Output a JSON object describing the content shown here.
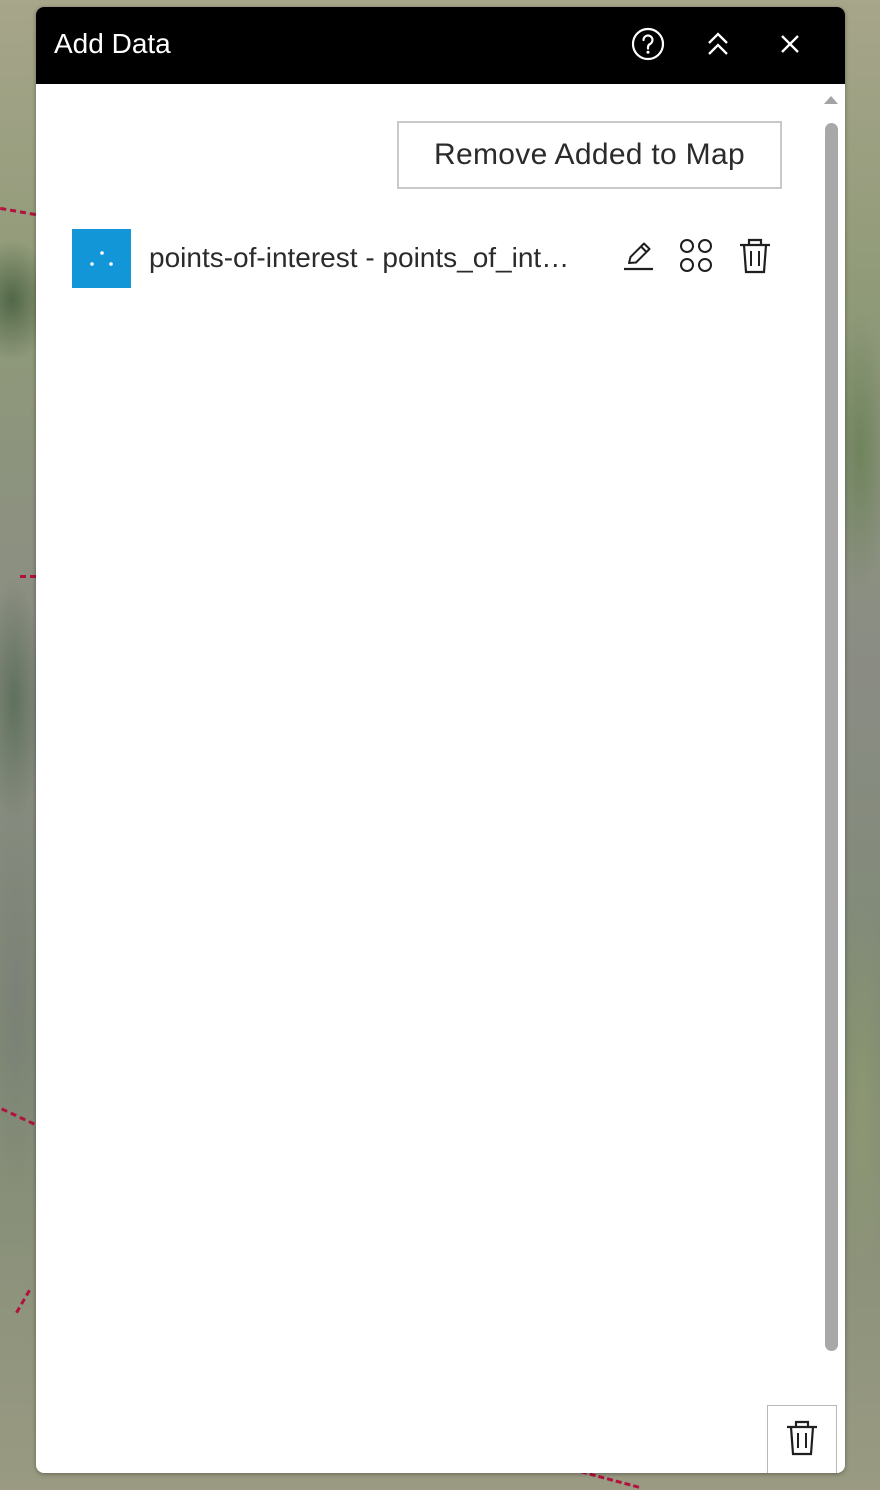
{
  "panel": {
    "title": "Add Data",
    "help_icon": "help-circle-icon",
    "collapse_icon": "chevrons-up-icon",
    "close_icon": "close-icon"
  },
  "toolbar": {
    "remove_added_label": "Remove Added to Map"
  },
  "layers": [
    {
      "name": "points-of-interest - points_of_int…",
      "thumbnail_icon": "point-layer-icon",
      "thumbnail_color": "#1296d8",
      "actions": [
        "edit-icon",
        "symbology-icon",
        "trash-icon"
      ]
    }
  ],
  "footer": {
    "remove_all_icon": "trash-icon"
  },
  "colors": {
    "header_bg": "#000000",
    "accent": "#1296d8",
    "route_line": "#b0123d"
  }
}
